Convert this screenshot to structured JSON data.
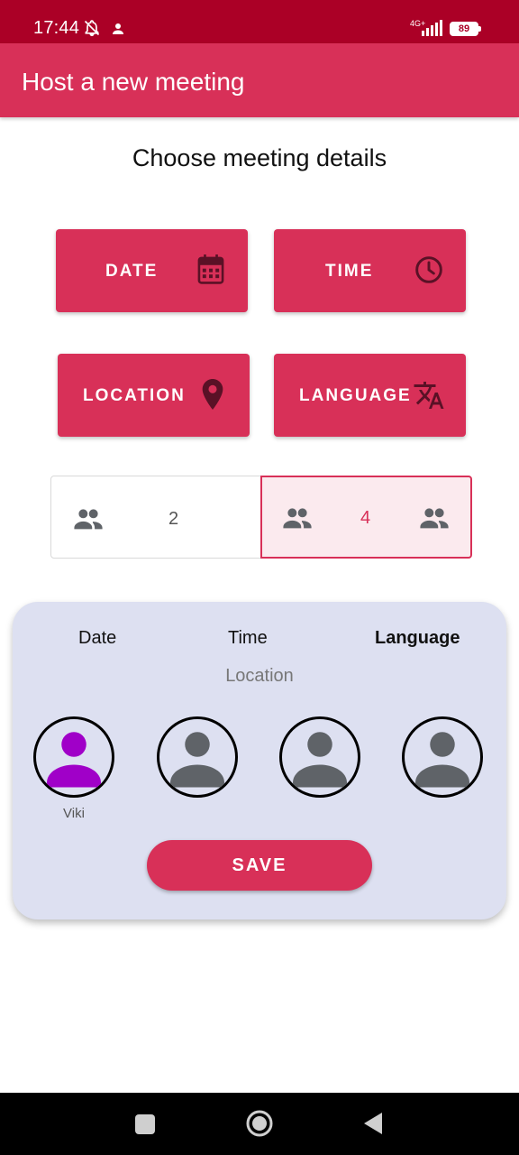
{
  "status_bar": {
    "time": "17:44",
    "network": "4G+",
    "battery": "89",
    "icons": [
      "bell-off-icon",
      "person-icon",
      "signal-icon",
      "battery-icon"
    ]
  },
  "app_bar": {
    "title": "Host a new meeting"
  },
  "page": {
    "subtitle": "Choose meeting details"
  },
  "buttons": {
    "date": {
      "label": "DATE",
      "icon": "calendar-icon"
    },
    "time": {
      "label": "TIME",
      "icon": "clock-icon"
    },
    "location": {
      "label": "LOCATION",
      "icon": "map-pin-icon"
    },
    "language": {
      "label": "LANGUAGE",
      "icon": "translate-icon"
    }
  },
  "participants_toggle": {
    "options": [
      {
        "value": "2",
        "selected": false
      },
      {
        "value": "4",
        "selected": true
      }
    ]
  },
  "summary_card": {
    "date_label": "Date",
    "time_label": "Time",
    "language_label": "Language",
    "location_label": "Location",
    "participants": [
      {
        "name": "Viki",
        "active": true
      },
      {
        "name": "",
        "active": false
      },
      {
        "name": "",
        "active": false
      },
      {
        "name": "",
        "active": false
      }
    ],
    "save_label": "SAVE"
  },
  "colors": {
    "primary": "#d83058",
    "status_bar": "#ab0026",
    "card_background": "#dde0f1",
    "active_avatar": "#a000c8",
    "inactive_avatar": "#5f6368"
  }
}
